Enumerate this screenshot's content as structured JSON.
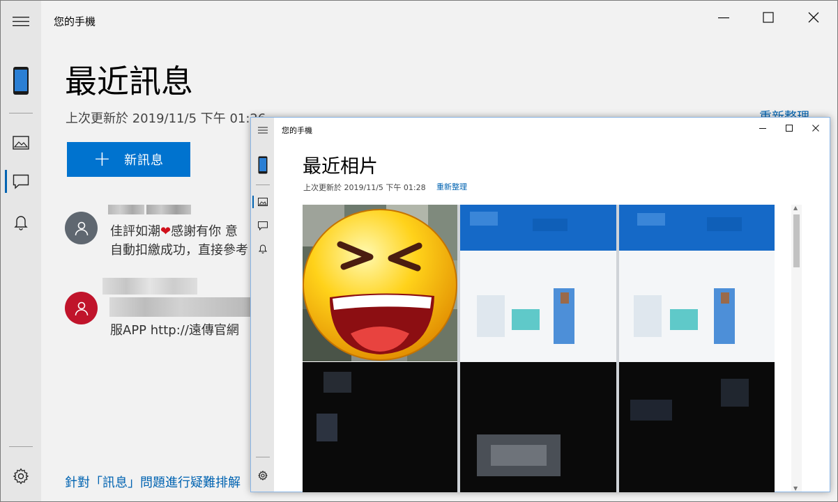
{
  "back_window": {
    "title": "您的手機",
    "heading": "最近訊息",
    "last_updated": "上次更新於 2019/11/5 下午 01:26",
    "refresh": "重新整理",
    "new_message_button": "新訊息",
    "messages": [
      {
        "line1": "佳評如潮",
        "line1_after": "感謝有你 意",
        "line2": "自動扣繳成功，直接參考"
      },
      {
        "line3": "服APP http://遠傳官網"
      }
    ],
    "troubleshoot_link": "針對「訊息」問題進行疑難排解",
    "accent_color": "#0063b1",
    "button_color": "#0073cf",
    "avatar_colors": [
      "#5f6770",
      "#c0142b"
    ]
  },
  "front_window": {
    "title": "您的手機",
    "heading": "最近相片",
    "last_updated": "上次更新於 2019/11/5 下午 01:28",
    "refresh": "重新整理"
  },
  "icons": [
    "hamburger-icon",
    "phone-icon",
    "photos-icon",
    "messages-icon",
    "notifications-icon",
    "settings-icon",
    "minimize-icon",
    "maximize-icon",
    "close-icon",
    "person-icon",
    "heart-emoji",
    "laughing-emoji"
  ]
}
